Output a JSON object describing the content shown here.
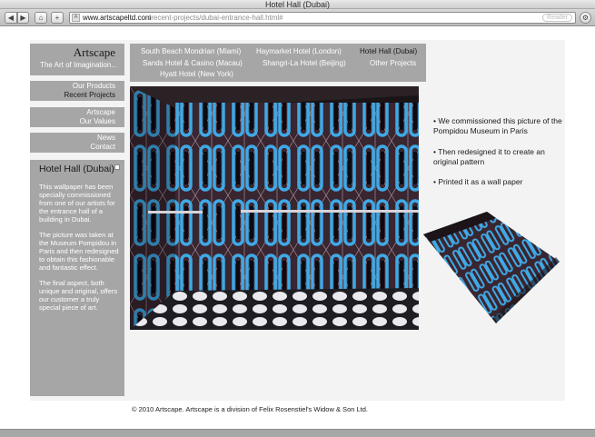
{
  "browser": {
    "window_title": "Hotel Hall (Dubai)",
    "url_domain": "www.artscapeltd.com",
    "url_path": "/recent-projects/dubai-entrance-hall.html#",
    "reader_label": "Reader"
  },
  "logo": {
    "title": "Artscape",
    "tagline": "The Art of Imagination..."
  },
  "sidebar": {
    "groups": [
      {
        "links": [
          "Our Products",
          "Recent Projects"
        ]
      },
      {
        "links": [
          "Artscape",
          "Our Values"
        ]
      },
      {
        "links": [
          "News",
          "Contact"
        ]
      }
    ]
  },
  "projects_nav": {
    "items": [
      "South Beach Mondrian (Miami)",
      "Haymarket Hotel (London)",
      "Hotel Hall (Dubai)",
      "Sands Hotel & Casino (Macau)",
      "Shangri-La Hotel (Beijing)",
      "Other Projects",
      "Hyatt Hotel (New York)"
    ],
    "active_index": 2
  },
  "info": {
    "title": "Hotel Hall (Dubai)",
    "paragraphs": [
      "This wallpaper has been specially commissioned from one of our artists for the entrance hall of a building in Dubai.",
      "The picture was taken at the Museum Pompidou in Paris and then redesigned to obtain this fashionable and fantastic effect.",
      "The final aspect, both unique and original, offers our customer a truly special piece of art."
    ]
  },
  "bullets": [
    "• We commissioned this picture of the Pompidou Museum in Paris",
    "• Then redesigned it to create an original pattern",
    "• Printed it as a wall paper"
  ],
  "footer": "© 2010 Artscape. Artscape is a division of Felix Rosenstiel's Widow & Son Ltd.",
  "colors": {
    "sidebar_gray": "#a6a6a6",
    "page_bg": "#f3f3f3",
    "neon_blue": "#3fa9e6",
    "wall_dark": "#3a2630"
  }
}
